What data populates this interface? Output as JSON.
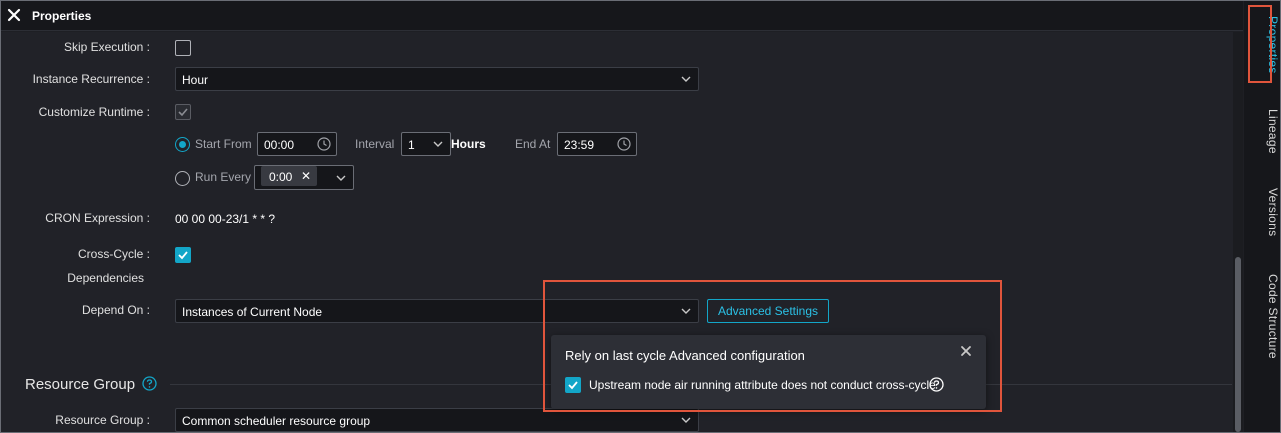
{
  "header": {
    "title": "Properties"
  },
  "form": {
    "skip_execution_label": "Skip Execution :",
    "instance_recurrence_label": "Instance Recurrence :",
    "instance_recurrence_value": "Hour",
    "customize_runtime_label": "Customize Runtime :",
    "start_from_label": "Start From",
    "start_from_value": "00:00",
    "interval_label": "Interval",
    "interval_value": "1",
    "hours_label": "Hours",
    "end_at_label": "End At",
    "end_at_value": "23:59",
    "run_every_label": "Run Every",
    "run_every_tag": "0:00",
    "cron_label": "CRON Expression :",
    "cron_value": "00 00 00-23/1 * * ?",
    "cross_cycle_label_1": "Cross-Cycle :",
    "cross_cycle_label_2": "Dependencies",
    "depend_on_label": "Depend On :",
    "depend_on_value": "Instances of Current Node",
    "advanced_settings_label": "Advanced Settings"
  },
  "resource_group": {
    "section_title": "Resource Group",
    "field_label": "Resource Group :",
    "field_value": "Common scheduler resource group"
  },
  "popover": {
    "title": "Rely on last cycle Advanced configuration",
    "option_label": "Upstream node air running attribute does not conduct cross-cycle"
  },
  "sidebar": {
    "tabs": [
      {
        "label": "Properties",
        "active": true
      },
      {
        "label": "Lineage",
        "active": false
      },
      {
        "label": "Versions",
        "active": false
      },
      {
        "label": "Code Structure",
        "active": false
      }
    ]
  },
  "colors": {
    "accent": "#13a6c8",
    "highlight": "#e0553c",
    "background": "#212228"
  },
  "icons": [
    "close-icon",
    "chevron-down-icon",
    "clock-icon",
    "check-icon",
    "help-circle-icon"
  ]
}
